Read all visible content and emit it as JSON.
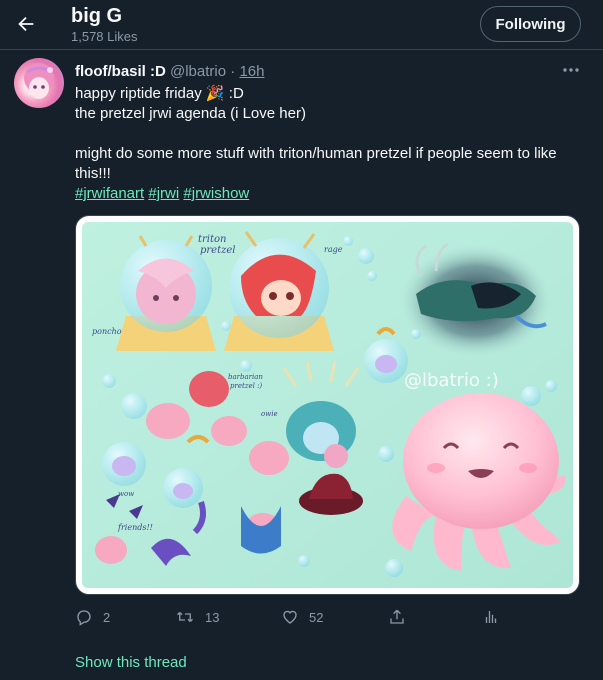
{
  "header": {
    "title": "big G",
    "likes_count": "1,578 Likes",
    "follow_label": "Following"
  },
  "tweet": {
    "author_name": "floof/basil :D",
    "handle": "@lbatrio",
    "separator": "·",
    "time": "16h",
    "line1_text": "happy riptide friday",
    "line1_emoji": "🎉",
    "line1_suffix": ":D",
    "line2": "the pretzel jrwi agenda (i Love her)",
    "line3": "might do some more stuff with triton/human pretzel if people seem to like this!!!",
    "hashtags": [
      "#jrwifanart",
      "#jrwi",
      "#jrwishow"
    ],
    "image_text": {
      "triton": "triton",
      "pretzel": "pretzel",
      "rage": "rage",
      "poncho": "poncho",
      "barbarian_1": "barbarian",
      "barbarian_2": "pretzel :)",
      "owie": "owie",
      "wow": "wow",
      "friends": "friends!!",
      "watermark": "@lbatrio :)"
    },
    "actions": {
      "replies": "2",
      "retweets": "13",
      "likes": "52"
    }
  },
  "show_thread": "Show this thread",
  "colors": {
    "background": "#15202b",
    "accent": "#6ee8bb",
    "muted": "#8b98a5",
    "border": "#38444d"
  },
  "icons": {
    "back": "arrow-left-icon",
    "more": "more-horizontal-icon",
    "reply": "reply-icon",
    "retweet": "retweet-icon",
    "like": "heart-icon",
    "share": "share-icon",
    "analytics": "analytics-icon"
  }
}
